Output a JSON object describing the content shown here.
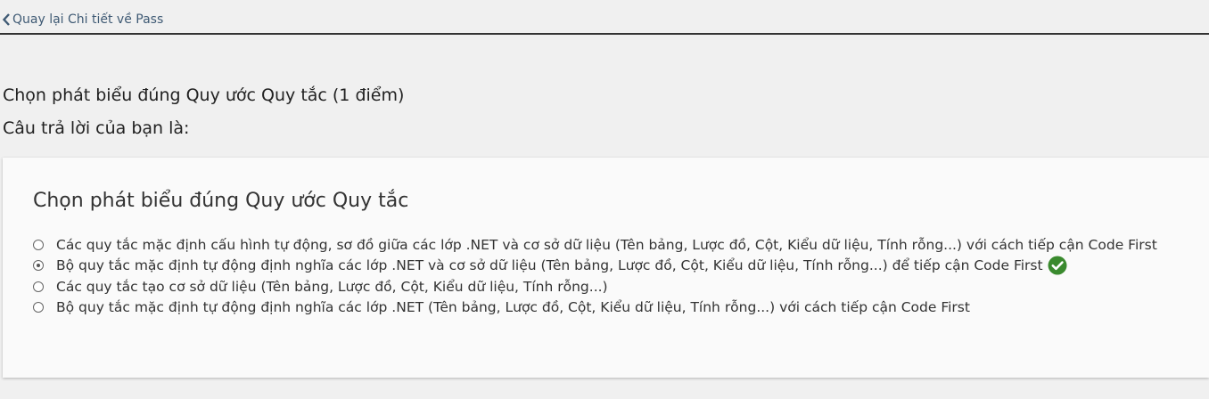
{
  "nav": {
    "back_label": "Quay lại Chi tiết về Pass"
  },
  "question": {
    "heading": "Chọn phát biểu đúng Quy ước Quy tắc (1 điểm)",
    "answer_label": "Câu trả lời của bạn là:"
  },
  "card": {
    "title": "Chọn phát biểu đúng Quy ước Quy tắc",
    "options": [
      {
        "label": "Các quy tắc mặc định cấu hình tự động, sơ đồ giữa các lớp .NET và cơ sở dữ liệu (Tên bảng, Lược đồ, Cột, Kiểu dữ liệu, Tính rỗng...) với cách tiếp cận Code First",
        "selected": false
      },
      {
        "label": "Bộ quy tắc mặc định tự động định nghĩa các lớp .NET và cơ sở dữ liệu (Tên bảng, Lược đồ, Cột, Kiểu dữ liệu, Tính rỗng...) để tiếp cận Code First",
        "selected": true,
        "correct_icon": "check-circle-icon"
      },
      {
        "label": "Các quy tắc tạo cơ sở dữ liệu (Tên bảng, Lược đồ, Cột, Kiểu dữ liệu, Tính rỗng...)",
        "selected": false
      },
      {
        "label": "Bộ quy tắc mặc định tự động định nghĩa các lớp .NET (Tên bảng, Lược đồ, Cột, Kiểu dữ liệu, Tính rỗng...) với cách tiếp cận Code First",
        "selected": false
      }
    ]
  },
  "colors": {
    "background": "#f0f0f0",
    "card_background": "#fafafa",
    "link": "#3f5a74",
    "correct_green": "#3a8a2e"
  }
}
